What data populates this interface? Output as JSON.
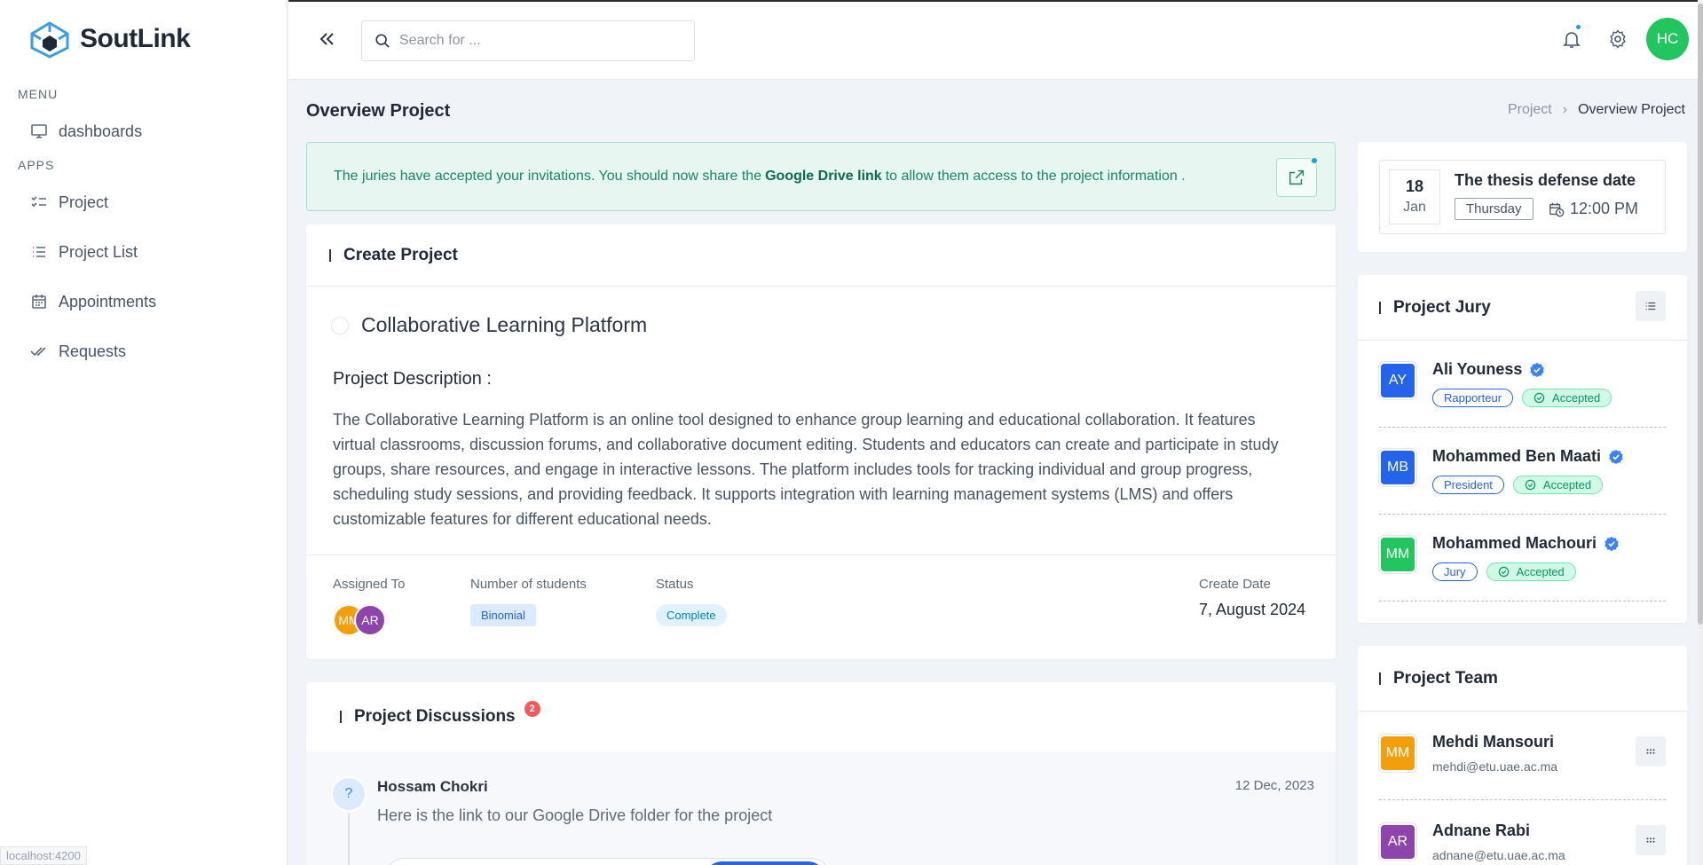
{
  "brand": {
    "name": "SoutLink"
  },
  "sidebar": {
    "sections": [
      {
        "title": "MENU",
        "items": [
          {
            "label": "dashboards",
            "icon": "monitor-icon"
          }
        ]
      },
      {
        "title": "APPS",
        "items": [
          {
            "label": "Project",
            "icon": "checklist-icon"
          },
          {
            "label": "Project List",
            "icon": "list-icon"
          },
          {
            "label": "Appointments",
            "icon": "calendar-icon"
          },
          {
            "label": "Requests",
            "icon": "double-check-icon"
          }
        ]
      }
    ]
  },
  "topbar": {
    "search_placeholder": "Search for ...",
    "user_initials": "HC",
    "user_color": "#22c55e"
  },
  "page": {
    "title": "Overview Project",
    "breadcrumb": [
      "Project",
      "Overview Project"
    ]
  },
  "alert": {
    "text_before": "The juries have accepted your invitations. You should now share the",
    "link": "Google Drive link",
    "text_after": "to allow them access to the project information ."
  },
  "project": {
    "section_title": "Create Project",
    "name": "Collaborative Learning Platform",
    "description_title": "Project Description :",
    "description": "The Collaborative Learning Platform is an online tool designed to enhance group learning and educational collaboration. It features virtual classrooms, discussion forums, and collaborative document editing. Students and educators can create and participate in study groups, share resources, and engage in interactive lessons. The platform includes tools for tracking individual and group progress, scheduling study sessions, and providing feedback. It supports integration with learning management systems (LMS) and offers customizable features for different educational needs.",
    "meta": {
      "assigned_label": "Assigned To",
      "assigned": [
        {
          "initials": "MM",
          "color": "#f59e0b"
        },
        {
          "initials": "AR",
          "color": "#8e44ad"
        }
      ],
      "students_label": "Number of students",
      "students_value": "Binomial",
      "status_label": "Status",
      "status_value": "Complete",
      "date_label": "Create Date",
      "date_value": "7, August 2024"
    }
  },
  "discussions": {
    "title": "Project Discussions",
    "count": "2",
    "items": [
      {
        "avatar": "?",
        "name": "Hossam Chokri",
        "date": "12 Dec, 2023",
        "text": "Here is the link to our Google Drive folder for the project"
      }
    ]
  },
  "defense": {
    "day": "18",
    "month": "Jan",
    "title": "The thesis defense date",
    "weekday": "Thursday",
    "time": "12:00 PM"
  },
  "jury": {
    "title": "Project Jury",
    "members": [
      {
        "initials": "AY",
        "name": "Ali Youness",
        "role": "Rapporteur",
        "status": "Accepted",
        "color": "#2563eb"
      },
      {
        "initials": "MB",
        "name": "Mohammed Ben Maati",
        "role": "President",
        "status": "Accepted",
        "color": "#2563eb"
      },
      {
        "initials": "MM",
        "name": "Mohammed Machouri",
        "role": "Jury",
        "status": "Accepted",
        "color": "#22c55e"
      }
    ]
  },
  "team": {
    "title": "Project Team",
    "members": [
      {
        "initials": "MM",
        "name": "Mehdi Mansouri",
        "email": "mehdi@etu.uae.ac.ma",
        "color": "#f59e0b"
      },
      {
        "initials": "AR",
        "name": "Adnane Rabi",
        "email": "adnane@etu.uae.ac.ma",
        "color": "#8e44ad"
      }
    ]
  },
  "footer": {
    "url": "localhost:4200"
  }
}
